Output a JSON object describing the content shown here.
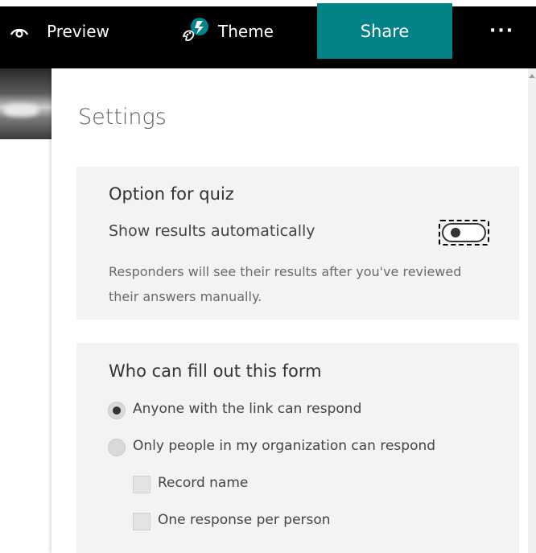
{
  "topbar": {
    "preview_label": "Preview",
    "theme_label": "Theme",
    "share_label": "Share",
    "more_label": "···"
  },
  "settings": {
    "title": "Settings",
    "quiz": {
      "heading": "Option for quiz",
      "show_results_label": "Show results automatically",
      "show_results_on": false,
      "description": "Responders will see their results after you've reviewed their answers manually."
    },
    "who": {
      "heading": "Who can fill out this form",
      "options": [
        {
          "label": "Anyone with the link can respond",
          "selected": true
        },
        {
          "label": "Only people in my organization can respond",
          "selected": false
        }
      ],
      "checkboxes": [
        {
          "label": "Record name",
          "checked": false
        },
        {
          "label": "One response per person",
          "checked": false
        }
      ]
    }
  },
  "colors": {
    "topbar_bg": "#000000",
    "share_bg": "#038387",
    "card_bg": "#f3f3f3"
  },
  "icons": [
    "eye-icon",
    "theme-brush-icon",
    "more-icon"
  ]
}
